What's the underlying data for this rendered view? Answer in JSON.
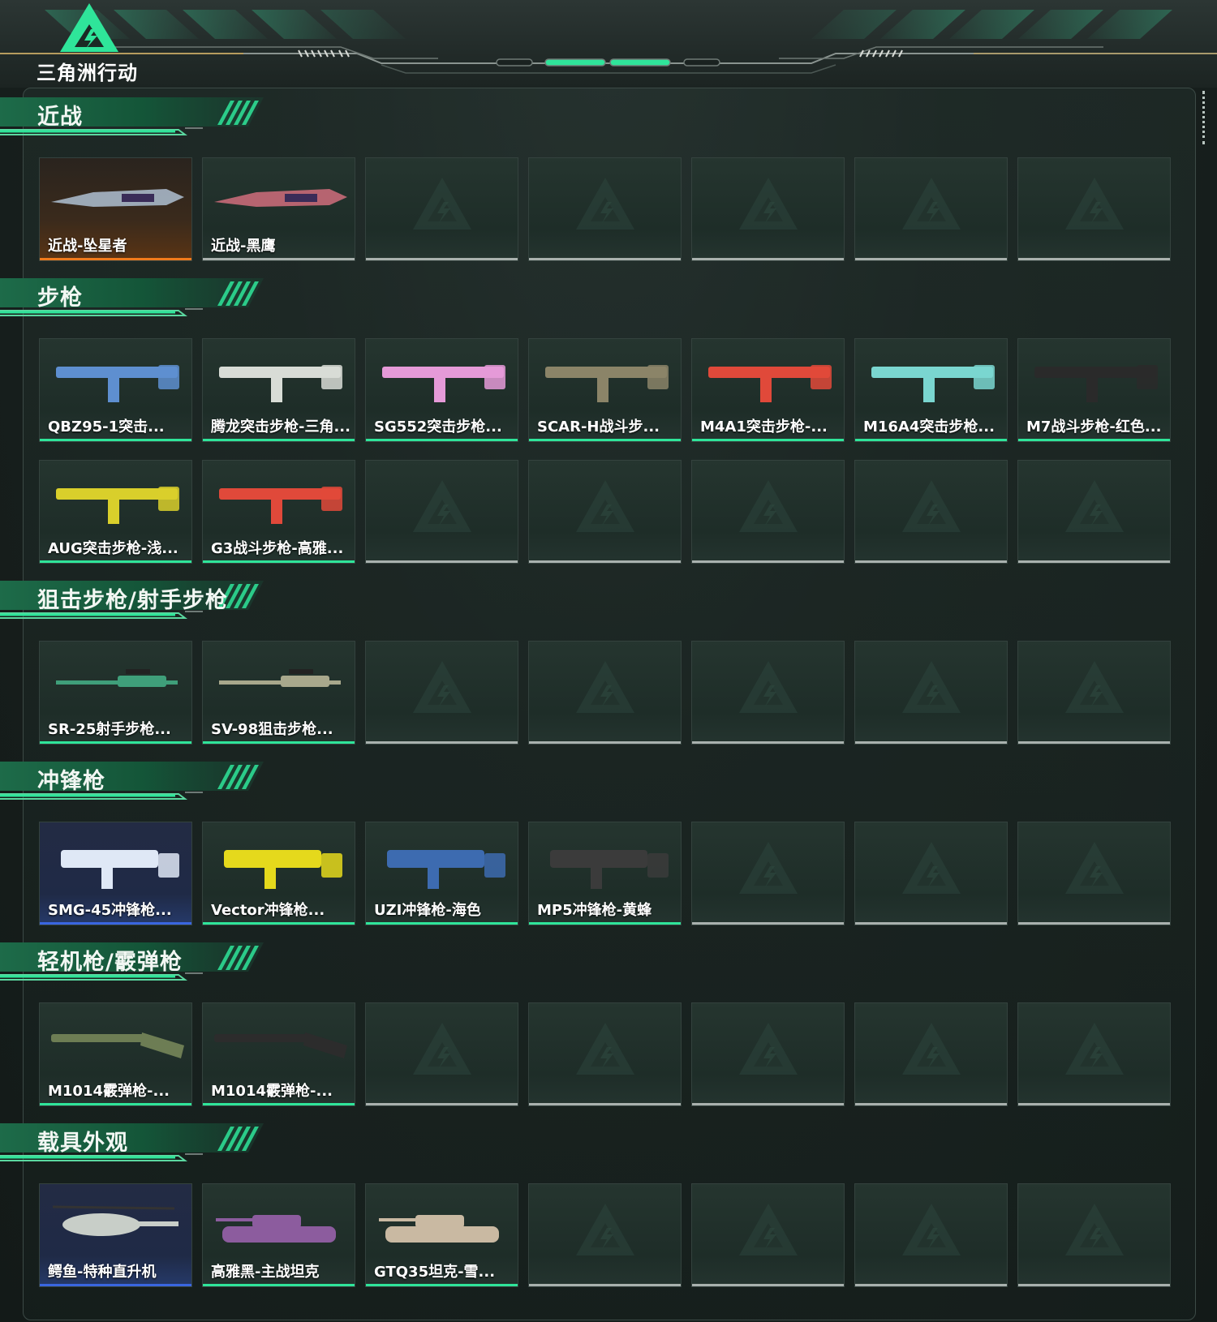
{
  "app": {
    "logo_text": "三角洲行动"
  },
  "colors": {
    "accent_green": "#2fe59a",
    "rarity_orange": "#f07a1c",
    "rarity_blue": "#3a66e0",
    "rarity_grey": "#a9b1ae"
  },
  "sections": [
    {
      "title": "近战",
      "rows": 1,
      "items": [
        {
          "name": "近战-坠星者",
          "rarity": "orange",
          "icon": "knife-icon"
        },
        {
          "name": "近战-黑鹰",
          "rarity": "grey",
          "icon": "knife-icon"
        }
      ]
    },
    {
      "title": "步枪",
      "rows": 2,
      "items": [
        {
          "name": "QBZ95-1突击...",
          "rarity": "green",
          "icon": "rifle-icon"
        },
        {
          "name": "腾龙突击步枪-三角...",
          "rarity": "green",
          "icon": "rifle-icon"
        },
        {
          "name": "SG552突击步枪...",
          "rarity": "green",
          "icon": "rifle-icon"
        },
        {
          "name": "SCAR-H战斗步...",
          "rarity": "green",
          "icon": "rifle-icon"
        },
        {
          "name": "M4A1突击步枪-...",
          "rarity": "green",
          "icon": "rifle-icon"
        },
        {
          "name": "M16A4突击步枪...",
          "rarity": "green",
          "icon": "rifle-icon"
        },
        {
          "name": "M7战斗步枪-红色...",
          "rarity": "green",
          "icon": "rifle-icon"
        },
        {
          "name": "AUG突击步枪-浅...",
          "rarity": "green",
          "icon": "rifle-icon"
        },
        {
          "name": "G3战斗步枪-高雅...",
          "rarity": "green",
          "icon": "rifle-icon"
        }
      ]
    },
    {
      "title": "狙击步枪/射手步枪",
      "rows": 1,
      "items": [
        {
          "name": "SR-25射手步枪...",
          "rarity": "green",
          "icon": "sniper-icon"
        },
        {
          "name": "SV-98狙击步枪...",
          "rarity": "green",
          "icon": "sniper-icon"
        }
      ]
    },
    {
      "title": "冲锋枪",
      "rows": 1,
      "items": [
        {
          "name": "SMG-45冲锋枪...",
          "rarity": "blue",
          "icon": "smg-icon"
        },
        {
          "name": "Vector冲锋枪...",
          "rarity": "green",
          "icon": "smg-icon"
        },
        {
          "name": "UZI冲锋枪-海色",
          "rarity": "green",
          "icon": "smg-icon"
        },
        {
          "name": "MP5冲锋枪-黄蜂",
          "rarity": "green",
          "icon": "smg-icon"
        }
      ]
    },
    {
      "title": "轻机枪/霰弹枪",
      "rows": 1,
      "items": [
        {
          "name": "M1014霰弹枪-...",
          "rarity": "green",
          "icon": "shotgun-icon"
        },
        {
          "name": "M1014霰弹枪-...",
          "rarity": "green",
          "icon": "shotgun-icon"
        }
      ]
    },
    {
      "title": "载具外观",
      "rows": 1,
      "items": [
        {
          "name": "鳄鱼-特种直升机",
          "rarity": "blue",
          "icon": "helicopter-icon"
        },
        {
          "name": "高雅黑-主战坦克",
          "rarity": "green",
          "icon": "tank-icon"
        },
        {
          "name": "GTQ35坦克-雪...",
          "rarity": "green",
          "icon": "tank-icon"
        }
      ]
    }
  ]
}
